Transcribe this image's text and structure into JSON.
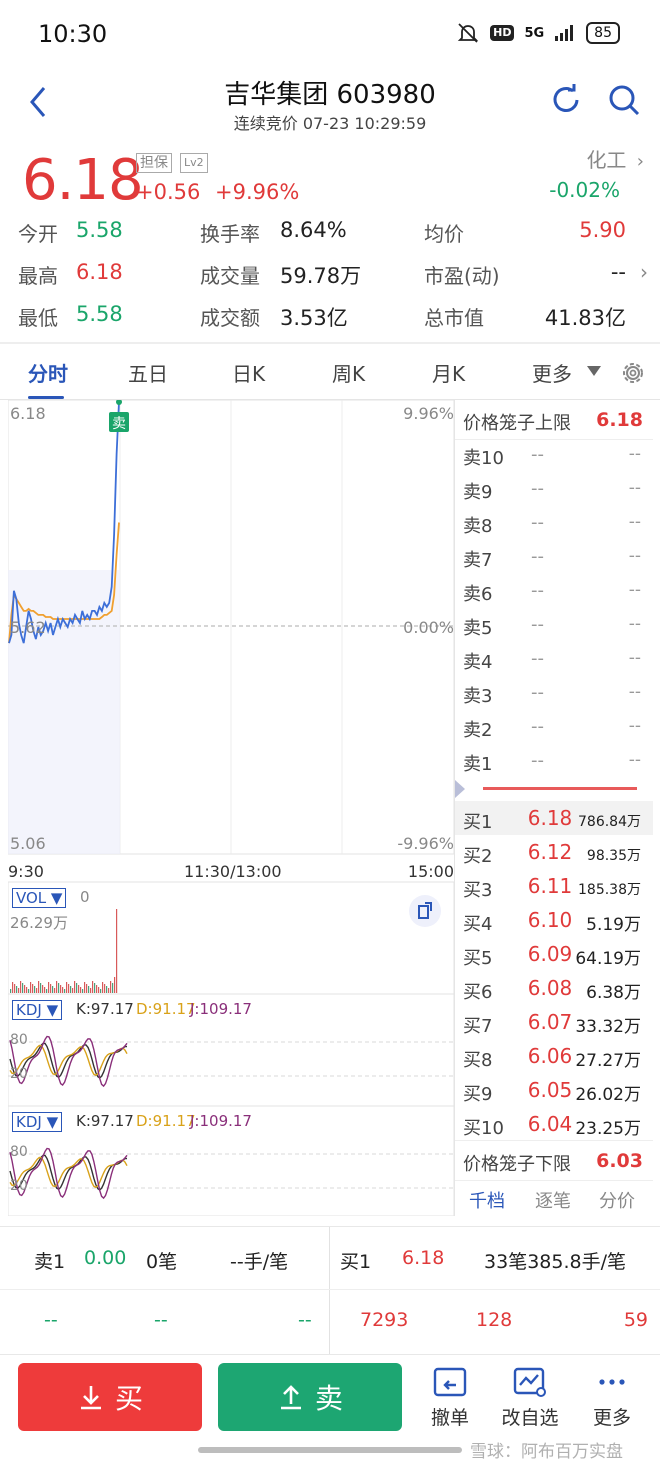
{
  "status_bar": {
    "time": "10:30",
    "hd": "HD",
    "network": "5G",
    "battery": "85"
  },
  "header": {
    "title": "吉华集团 603980",
    "subtitle": "连续竞价 07-23 10:29:59"
  },
  "quote": {
    "price": "6.18",
    "change": "+0.56",
    "change_pct": "+9.96%",
    "margin_badge": "担保",
    "level_badge": "Lv2",
    "sector": "化工",
    "sector_change": "-0.02%"
  },
  "stats": {
    "open_label": "今开",
    "open": "5.58",
    "turnover_rate_label": "换手率",
    "turnover_rate": "8.64%",
    "avg_label": "均价",
    "avg": "5.90",
    "high_label": "最高",
    "high": "6.18",
    "volume_label": "成交量",
    "volume": "59.78万",
    "pe_label": "市盈(动)",
    "pe": "--",
    "low_label": "最低",
    "low": "5.58",
    "amount_label": "成交额",
    "amount": "3.53亿",
    "mcap_label": "总市值",
    "mcap": "41.83亿"
  },
  "tabs": [
    "分时",
    "五日",
    "日K",
    "周K",
    "月K",
    "更多"
  ],
  "chart": {
    "y_top": "6.18",
    "y_mid": "5.62",
    "y_bottom": "5.06",
    "pct_top": "9.96%",
    "pct_mid": "0.00%",
    "pct_bottom": "-9.96%",
    "x_start": "9:30",
    "x_mid": "11:30/13:00",
    "x_end": "15:00",
    "sell_marker": "卖",
    "vol_selector": "VOL ▼",
    "vol_value": "0",
    "vol_max": "26.29万",
    "kdj1_selector": "KDJ ▼",
    "kdj1_k": "K:97.17",
    "kdj1_d": "D:91.17",
    "kdj1_j": "J:109.17",
    "kdj1_l1": "80",
    "kdj1_l2": "20",
    "kdj2_selector": "KDJ ▼",
    "kdj2_k": "K:97.17",
    "kdj2_d": "D:91.17",
    "kdj2_j": "J:109.17",
    "kdj2_l1": "80",
    "kdj2_l2": "20"
  },
  "chart_data": {
    "type": "line",
    "ylim": [
      5.06,
      6.18
    ],
    "y_ref": 5.62,
    "series": [
      {
        "values": [
          5.58,
          5.6,
          5.71,
          5.69,
          5.63,
          5.6,
          5.58,
          5.62,
          5.66,
          5.64,
          5.61,
          5.59,
          5.62,
          5.6,
          5.61,
          5.63,
          5.61,
          5.63,
          5.6,
          5.62,
          5.64,
          5.62,
          5.64,
          5.63,
          5.62,
          5.64,
          5.63,
          5.65,
          5.64,
          5.63,
          5.66,
          5.64,
          5.65,
          5.64,
          5.66,
          5.66,
          5.65,
          5.67,
          5.66,
          5.68,
          5.67,
          5.68,
          5.72,
          5.85,
          6.05,
          6.18
        ]
      },
      {
        "values": [
          5.58,
          5.65,
          5.7,
          5.69,
          5.68,
          5.67,
          5.66,
          5.66,
          5.665,
          5.66,
          5.66,
          5.655,
          5.65,
          5.65,
          5.65,
          5.645,
          5.645,
          5.645,
          5.64,
          5.64,
          5.64,
          5.64,
          5.64,
          5.64,
          5.64,
          5.64,
          5.64,
          5.64,
          5.64,
          5.64,
          5.64,
          5.64,
          5.64,
          5.64,
          5.64,
          5.64,
          5.64,
          5.64,
          5.645,
          5.65,
          5.65,
          5.655,
          5.66,
          5.7,
          5.8,
          5.88
        ]
      }
    ]
  },
  "order_book": {
    "limit_up_label": "价格笼子上限",
    "limit_up": "6.18",
    "limit_down_label": "价格笼子下限",
    "limit_down": "6.03",
    "asks": [
      {
        "label": "卖10",
        "price": "--",
        "vol": "--"
      },
      {
        "label": "卖9",
        "price": "--",
        "vol": "--"
      },
      {
        "label": "卖8",
        "price": "--",
        "vol": "--"
      },
      {
        "label": "卖7",
        "price": "--",
        "vol": "--"
      },
      {
        "label": "卖6",
        "price": "--",
        "vol": "--"
      },
      {
        "label": "卖5",
        "price": "--",
        "vol": "--"
      },
      {
        "label": "卖4",
        "price": "--",
        "vol": "--"
      },
      {
        "label": "卖3",
        "price": "--",
        "vol": "--"
      },
      {
        "label": "卖2",
        "price": "--",
        "vol": "--"
      },
      {
        "label": "卖1",
        "price": "--",
        "vol": "--"
      }
    ],
    "bids": [
      {
        "label": "买1",
        "price": "6.18",
        "vol": "786.84万"
      },
      {
        "label": "买2",
        "price": "6.12",
        "vol": "98.35万"
      },
      {
        "label": "买3",
        "price": "6.11",
        "vol": "185.38万"
      },
      {
        "label": "买4",
        "price": "6.10",
        "vol": "5.19万"
      },
      {
        "label": "买5",
        "price": "6.09",
        "vol": "64.19万"
      },
      {
        "label": "买6",
        "price": "6.08",
        "vol": "6.38万"
      },
      {
        "label": "买7",
        "price": "6.07",
        "vol": "33.32万"
      },
      {
        "label": "买8",
        "price": "6.06",
        "vol": "27.27万"
      },
      {
        "label": "买9",
        "price": "6.05",
        "vol": "26.02万"
      },
      {
        "label": "买10",
        "price": "6.04",
        "vol": "23.25万"
      }
    ],
    "tabs": [
      "千档",
      "逐笔",
      "分价"
    ]
  },
  "trade_summary": {
    "sell_label": "卖1",
    "sell_price": "0.00",
    "sell_count": "0笔",
    "sell_avg": "--手/笔",
    "buy_label": "买1",
    "buy_price": "6.18",
    "buy_info": "33笔385.8手/笔",
    "left_row": [
      "--",
      "--",
      "--"
    ],
    "right_row": [
      "7293",
      "128",
      "59"
    ]
  },
  "bottom_bar": {
    "buy": "买",
    "sell": "卖",
    "cancel": "撤单",
    "edit_watch": "改自选",
    "more": "更多",
    "watermark": "雪球：阿布百万实盘"
  }
}
